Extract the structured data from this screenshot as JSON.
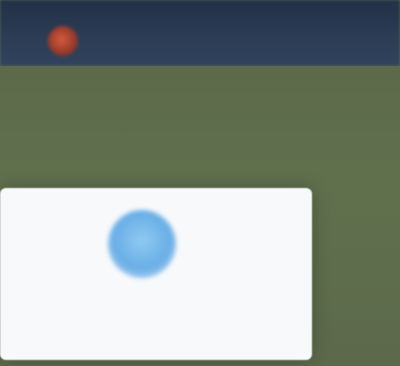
{
  "colors": {
    "header_bg": "#2c3c55",
    "page_bg": "#5c6b4c",
    "modal_bg": "#f7f9fb",
    "accent_blue": "#6aaee6",
    "logo_red": "#c0452e"
  },
  "header": {
    "logo_icon": "red-circle-logo",
    "brand_text": ""
  },
  "modal": {
    "icon": "blue-circle-icon",
    "title": "",
    "text": "",
    "link": ""
  }
}
